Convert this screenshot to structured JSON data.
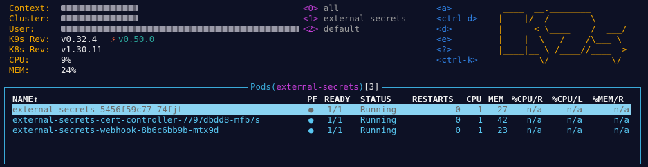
{
  "info": {
    "context_label": "Context:",
    "cluster_label": "Cluster:",
    "user_label": "User:",
    "k9s_rev_label": "K9s Rev:",
    "k9s_rev_value": "v0.32.4",
    "k9s_update": "v0.50.0",
    "k8s_rev_label": "K8s Rev:",
    "k8s_rev_value": "v1.30.11",
    "cpu_label": "CPU:",
    "cpu_value": "9%",
    "mem_label": "MEM:",
    "mem_value": "24%"
  },
  "namespaces": [
    {
      "key": "<0>",
      "name": "all"
    },
    {
      "key": "<1>",
      "name": "external-secrets"
    },
    {
      "key": "<2>",
      "name": "default"
    }
  ],
  "hotkeys": [
    "<a>",
    "<ctrl-d>",
    "<d>",
    "<e>",
    "<?>",
    "<ctrl-k>"
  ],
  "logo_lines": [
    " ____  __.________       ",
    "|    |/ _/   __   \\______",
    "|      < \\____    /  ___/",
    "|    |  \\   /    /\\___ \\ ",
    "|____|__ \\ /____//____  >",
    "        \\/            \\/ "
  ],
  "panel": {
    "title_resource": "Pods",
    "title_namespace": "external-secrets",
    "title_count": "[3]"
  },
  "columns": {
    "name": "NAME",
    "pf": "PF",
    "ready": "READY",
    "status": "STATUS",
    "restarts": "RESTARTS",
    "cpu": "CPU",
    "mem": "MEM",
    "cpu_r": "%CPU/R",
    "cpu_l": "%CPU/L",
    "mem_r": "%MEM/R"
  },
  "pods": [
    {
      "name": "external-secrets-5456f59c77-74fjt",
      "pf": "●",
      "ready": "1/1",
      "status": "Running",
      "restarts": "0",
      "cpu": "1",
      "mem": "27",
      "cpu_r": "n/a",
      "cpu_l": "n/a",
      "mem_r": "n/a"
    },
    {
      "name": "external-secrets-cert-controller-7797dbdd8-mfb7s",
      "pf": "●",
      "ready": "1/1",
      "status": "Running",
      "restarts": "0",
      "cpu": "1",
      "mem": "42",
      "cpu_r": "n/a",
      "cpu_l": "n/a",
      "mem_r": "n/a"
    },
    {
      "name": "external-secrets-webhook-8b6c6bb9b-mtx9d",
      "pf": "●",
      "ready": "1/1",
      "status": "Running",
      "restarts": "0",
      "cpu": "1",
      "mem": "23",
      "cpu_r": "n/a",
      "cpu_l": "n/a",
      "mem_r": "n/a"
    }
  ],
  "colors": {
    "background": "#0d1125",
    "label": "#f0a500",
    "namespace_index": "#c43fd7",
    "hotkey": "#2f7fe0",
    "border": "#3aa9d8",
    "row_text": "#58c6f0",
    "selected_row_bg": "#8ad3f2"
  }
}
